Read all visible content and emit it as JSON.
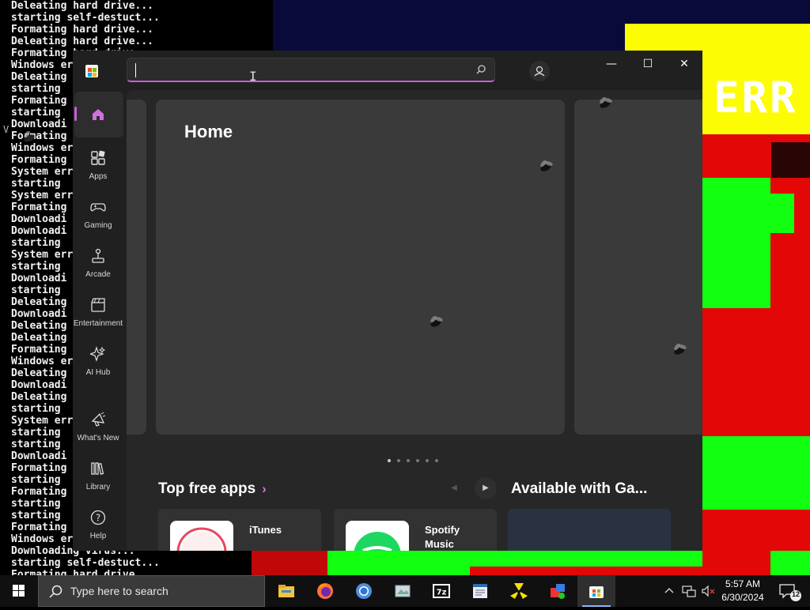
{
  "terminal": {
    "lines": [
      "Deleating hard drive...",
      "starting self-destuct...",
      "Formating hard drive...",
      "Deleating hard drive...",
      "Formating hard drive...",
      "Windows er",
      "Deleating ",
      "starting ",
      "Formating ",
      "starting ",
      "Downloadi",
      "Formating ",
      "Windows er",
      "Formating ",
      "System err",
      "starting ",
      "System err",
      "Formating ",
      "Downloadi",
      "Downloadi",
      "starting ",
      "System err",
      "starting ",
      "Downloadi",
      "starting ",
      "Deleating ",
      "Downloadi",
      "Deleating ",
      "Deleating ",
      "Formating ",
      "Windows er",
      "Deleating ",
      "Downloadi",
      "Deleating ",
      "starting ",
      "System err",
      "starting ",
      "starting ",
      "Downloadi",
      "Formating ",
      "starting ",
      "Formating ",
      "starting ",
      "starting ",
      "Formating ",
      "Windows er",
      "Downloading virus...",
      "starting self-destuct...",
      "Formating hard drive..."
    ]
  },
  "background": {
    "error_text": "ERR"
  },
  "store": {
    "search": {
      "value": "",
      "placeholder": ""
    },
    "window_controls": {
      "minimize": "—",
      "maximize": "☐",
      "close": "✕"
    },
    "nav": [
      {
        "label": "",
        "icon": "home-icon",
        "active": true
      },
      {
        "label": "Apps",
        "icon": "apps-icon"
      },
      {
        "label": "Gaming",
        "icon": "gamepad-icon"
      },
      {
        "label": "Arcade",
        "icon": "joystick-icon"
      },
      {
        "label": "Entertainment",
        "icon": "clapperboard-icon"
      },
      {
        "label": "AI Hub",
        "icon": "sparkle-icon"
      },
      {
        "label": "What's New",
        "icon": "megaphone-icon"
      },
      {
        "label": "Library",
        "icon": "library-icon"
      },
      {
        "label": "Help",
        "icon": "help-icon"
      }
    ],
    "home_title": "Home",
    "carousel": {
      "dot_count": 6,
      "active_index": 0
    },
    "sections": {
      "top_free": "Top free apps",
      "top_free_chevron": "›",
      "available": "Available with Ga..."
    },
    "apps": [
      {
        "name": "iTunes"
      },
      {
        "name": "Spotify Music"
      }
    ],
    "colors": {
      "accent": "#c95fd8",
      "window_bg": "#202020",
      "card_bg": "#3a3a3a"
    }
  },
  "taskbar": {
    "search_placeholder": "Type here to search",
    "apps": [
      "file-explorer-icon",
      "firefox-icon",
      "chrome-icon",
      "image-viewer-icon",
      "7zip-icon",
      "notepad-icon",
      "radioactive-icon",
      "paint-icon",
      "store-icon"
    ],
    "time": "5:57 AM",
    "date": "6/30/2024",
    "notifications": "12"
  }
}
